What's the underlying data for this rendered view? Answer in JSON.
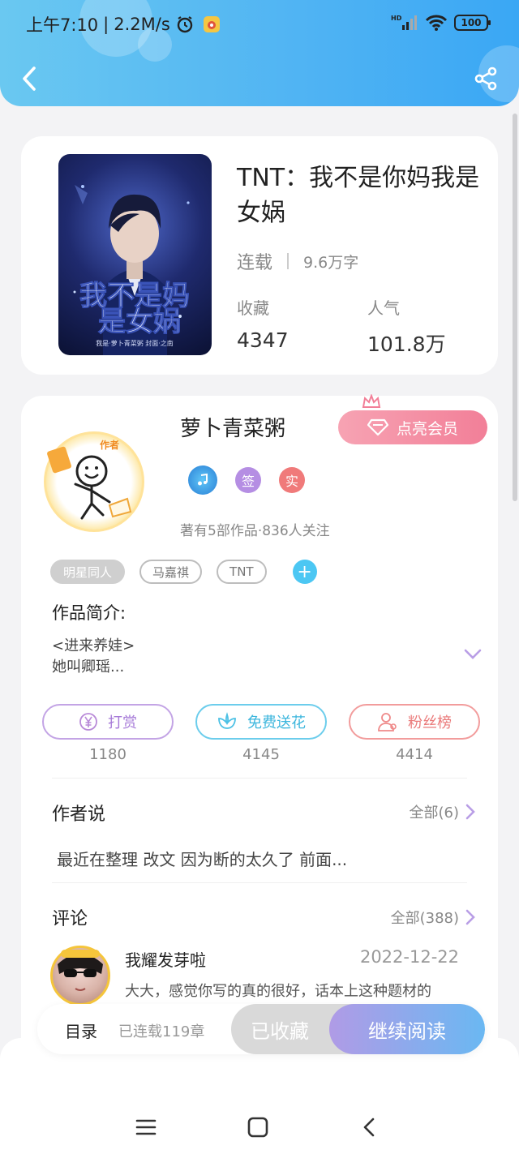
{
  "status_bar": {
    "time": "上午7:10",
    "speed": "2.2M/s",
    "signal": "HD",
    "battery": "100"
  },
  "book": {
    "title": "TNT：我不是你妈我是女娲",
    "status": "连载",
    "word_count": "9.6万字",
    "favorites_label": "收藏",
    "favorites_value": "4347",
    "popularity_label": "人气",
    "popularity_value": "101.8万",
    "cover_title": "我不是妈是女娲",
    "cover_sub": "我是·萝卜青菜粥 封面·之南"
  },
  "author": {
    "name": "萝卜青菜粥",
    "avatar_badge": "作者",
    "vip_label": "点亮会员",
    "badge_sign": "签",
    "badge_real": "实",
    "works": "著有5部作品·836人关注",
    "tags": [
      "明星同人",
      "马嘉祺",
      "TNT"
    ],
    "intro_heading": "作品简介:",
    "intro_line1": "<进来养娃>",
    "intro_line2": "她叫卿瑶..."
  },
  "actions": [
    {
      "label": "打赏",
      "count": "1180",
      "icon": "yen-icon",
      "color": "#b98ad8"
    },
    {
      "label": "免费送花",
      "count": "4145",
      "icon": "flower-icon",
      "color": "#4dc1e5"
    },
    {
      "label": "粉丝榜",
      "count": "4414",
      "icon": "fans-icon",
      "color": "#ef8a8a"
    }
  ],
  "author_says": {
    "heading": "作者说",
    "more": "全部(6)",
    "text": "最近在整理 改文 因为断的太久了 前面..."
  },
  "comments": {
    "heading": "评论",
    "more": "全部(388)",
    "items": [
      {
        "user": "我耀发芽啦",
        "date": "2022-12-22",
        "text": "大大，感觉你写的真的很好，话本上这种题材的书，我都看过几本，感觉你"
      }
    ]
  },
  "bottom_bar": {
    "toc": "目录",
    "chapters": "已连载119章",
    "favorited": "已收藏",
    "continue": "继续阅读"
  },
  "colors": {
    "header": "#4fb3f3",
    "accent_purple": "#b09be6",
    "vip_pink": "#f27f98"
  }
}
